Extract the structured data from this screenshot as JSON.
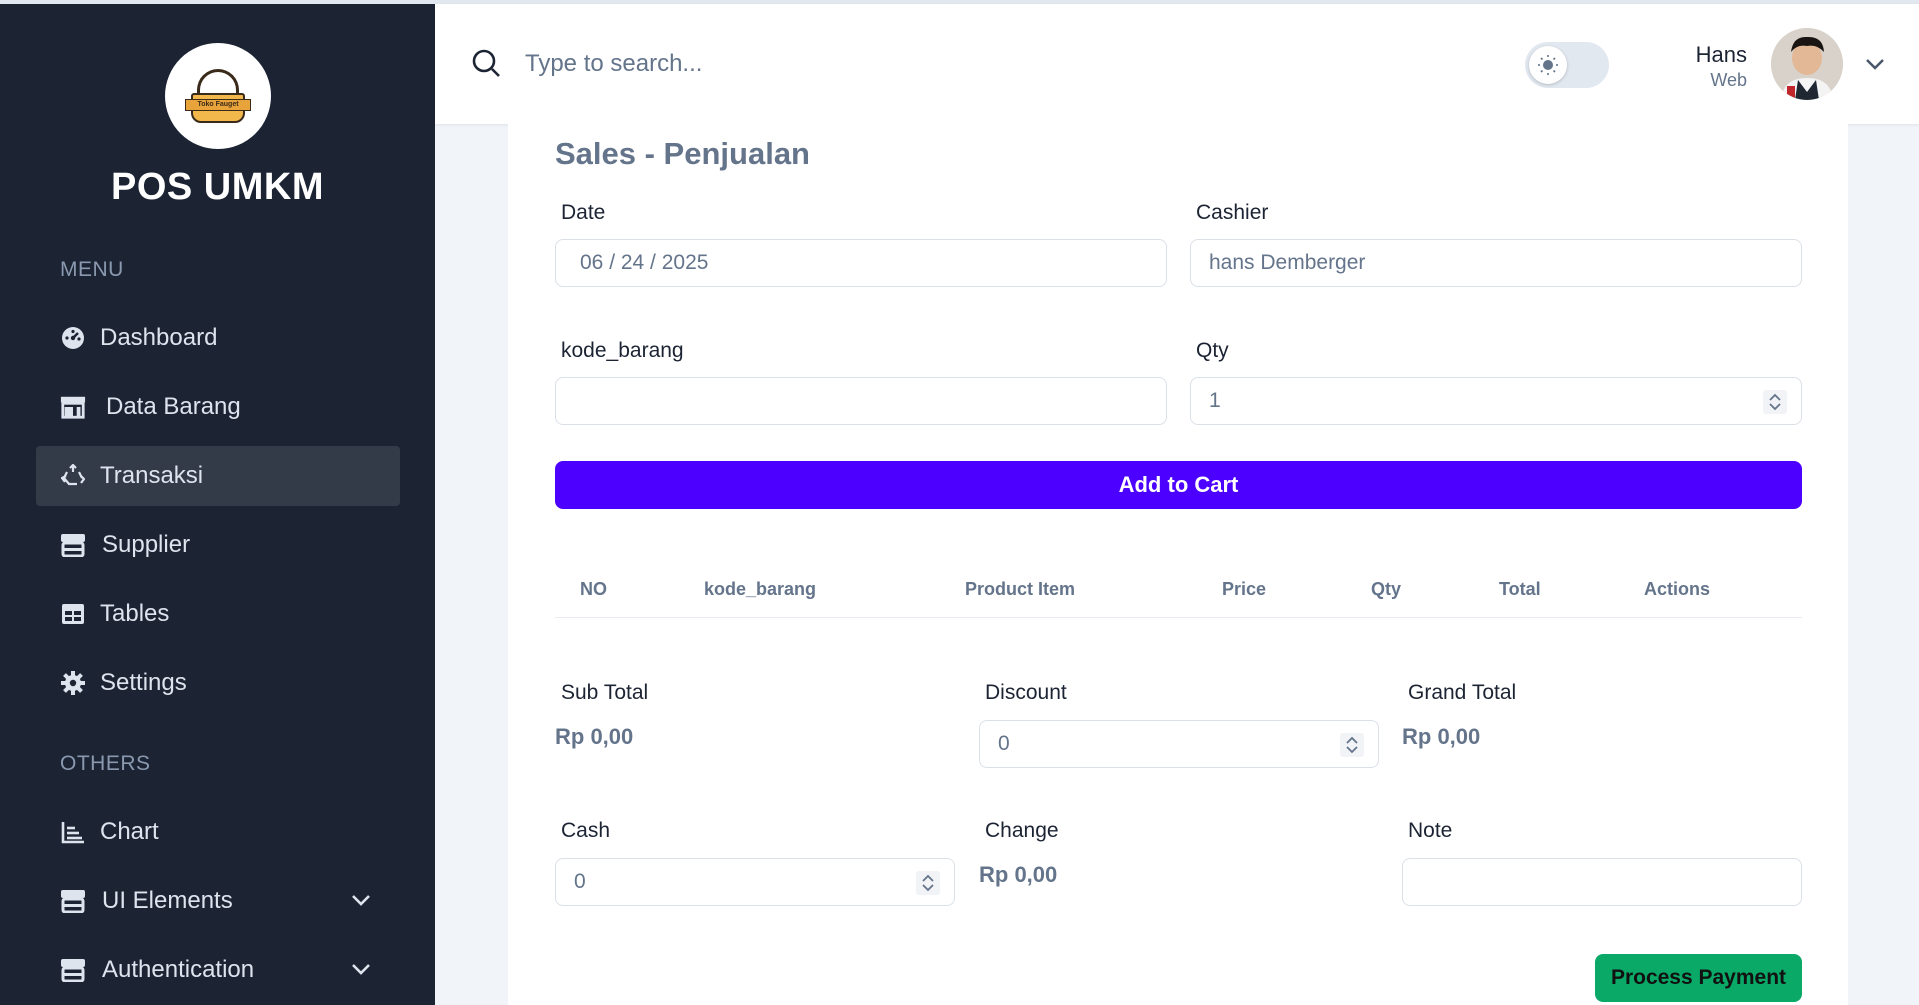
{
  "sidebar": {
    "brand": "POS UMKM",
    "logo_text": "Toko Fauget",
    "menu_label": "MENU",
    "others_label": "OTHERS",
    "items": [
      {
        "label": "Dashboard",
        "icon": "dashboard-icon"
      },
      {
        "label": "Data Barang",
        "icon": "store-icon"
      },
      {
        "label": "Transaksi",
        "icon": "recycle-icon",
        "active": true
      },
      {
        "label": "Supplier",
        "icon": "shop-icon"
      },
      {
        "label": "Tables",
        "icon": "table-icon"
      },
      {
        "label": "Settings",
        "icon": "gear-icon"
      }
    ],
    "others": [
      {
        "label": "Chart",
        "icon": "chart-icon"
      },
      {
        "label": "UI Elements",
        "icon": "shop-icon",
        "expandable": true
      },
      {
        "label": "Authentication",
        "icon": "shop-icon",
        "expandable": true
      }
    ]
  },
  "header": {
    "search_placeholder": "Type to search...",
    "user_name": "Hans",
    "user_role": "Web"
  },
  "main": {
    "title": "Sales - Penjualan",
    "date_label": "Date",
    "date_value": "06 / 24 / 2025",
    "cashier_label": "Cashier",
    "cashier_value": "hans Demberger",
    "kode_label": "kode_barang",
    "kode_value": "",
    "qty_label": "Qty",
    "qty_value": "1",
    "add_to_cart": "Add to Cart",
    "table_headers": [
      "NO",
      "kode_barang",
      "Product Item",
      "Price",
      "Qty",
      "Total",
      "Actions"
    ],
    "subtotal_label": "Sub Total",
    "subtotal_value": "Rp 0,00",
    "discount_label": "Discount",
    "discount_value": "0",
    "grandtotal_label": "Grand Total",
    "grandtotal_value": "Rp 0,00",
    "cash_label": "Cash",
    "cash_value": "0",
    "change_label": "Change",
    "change_value": "Rp 0,00",
    "note_label": "Note",
    "note_value": "",
    "process_payment": "Process Payment"
  },
  "colors": {
    "sidebar_bg": "#1c2434",
    "primary": "#4c00ff",
    "success": "#0aa968"
  }
}
